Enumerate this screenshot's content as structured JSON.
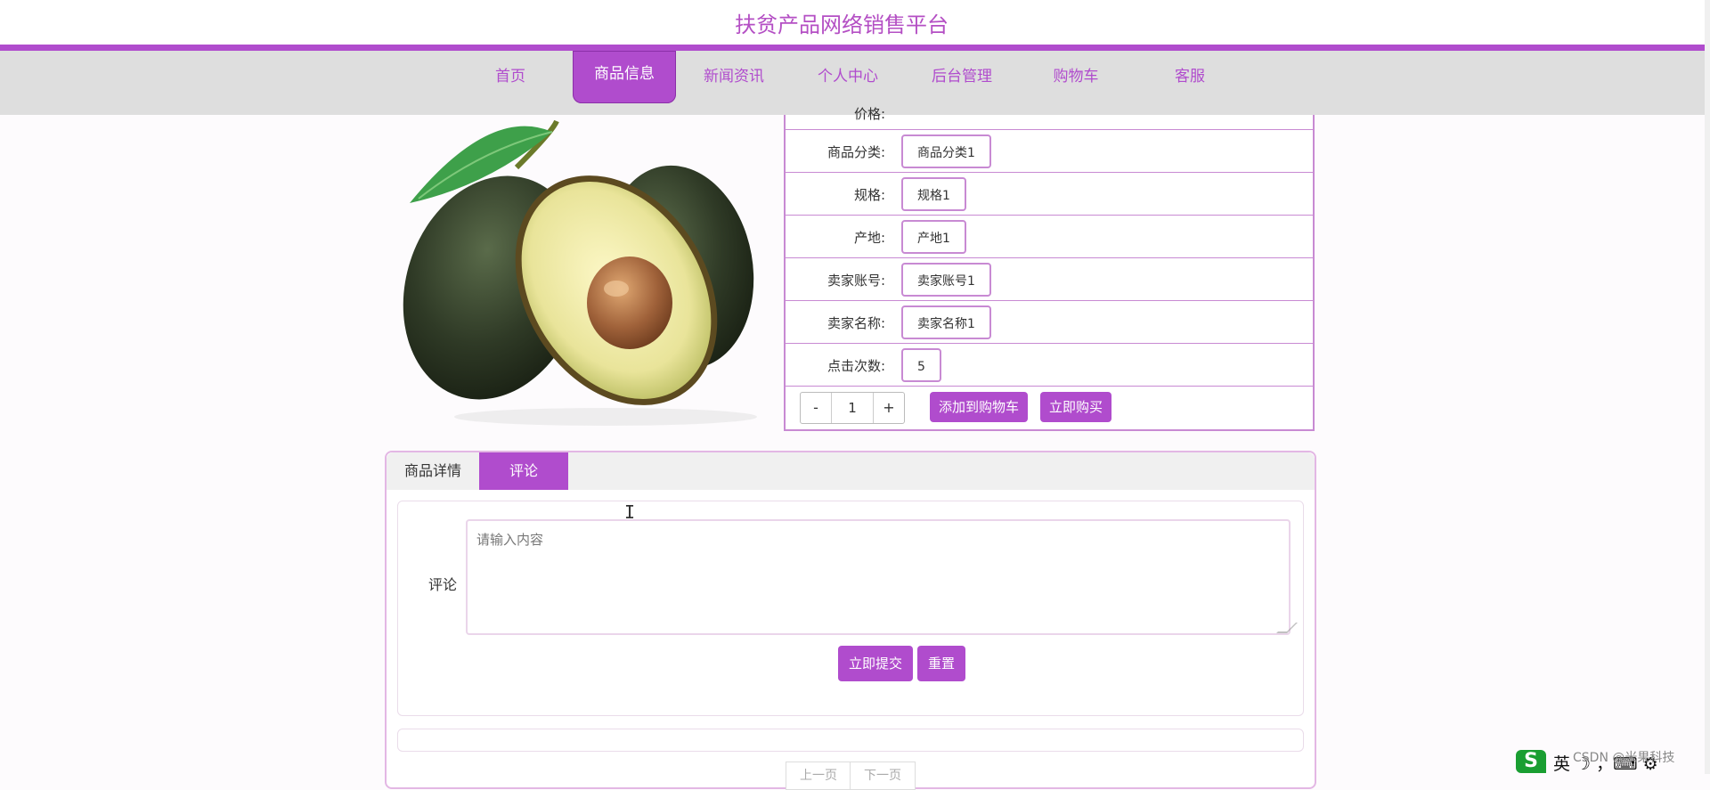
{
  "header": {
    "title": "扶贫产品网络销售平台"
  },
  "nav": {
    "items": [
      {
        "label": "首页"
      },
      {
        "label": "商品信息"
      },
      {
        "label": "新闻资讯"
      },
      {
        "label": "个人中心"
      },
      {
        "label": "后台管理"
      },
      {
        "label": "购物车"
      },
      {
        "label": "客服"
      }
    ],
    "active_index": 1
  },
  "product": {
    "partial_top_label": "价格:",
    "fields": [
      {
        "label": "商品分类:",
        "value": "商品分类1"
      },
      {
        "label": "规格:",
        "value": "规格1"
      },
      {
        "label": "产地:",
        "value": "产地1"
      },
      {
        "label": "卖家账号:",
        "value": "卖家账号1"
      },
      {
        "label": "卖家名称:",
        "value": "卖家名称1"
      },
      {
        "label": "点击次数:",
        "value": "5"
      }
    ],
    "quantity": {
      "minus": "-",
      "value": "1",
      "plus": "+"
    },
    "add_to_cart_label": "添加到购物车",
    "buy_now_label": "立即购买"
  },
  "tabs": {
    "detail_label": "商品详情",
    "comment_label": "评论"
  },
  "comment_form": {
    "label": "评论",
    "placeholder": "请输入内容",
    "submit_label": "立即提交",
    "reset_label": "重置"
  },
  "pager": {
    "prev_label": "上一页",
    "next_label": "下一页"
  },
  "overlay": {
    "watermark": "CSDN @米果科技",
    "ime_logo": "S",
    "ime_text": "英 ☽ ，⌨ ⚙"
  },
  "colors": {
    "accent": "#b04ccd",
    "nav_bg": "#dedede",
    "border": "#c88ad3"
  }
}
